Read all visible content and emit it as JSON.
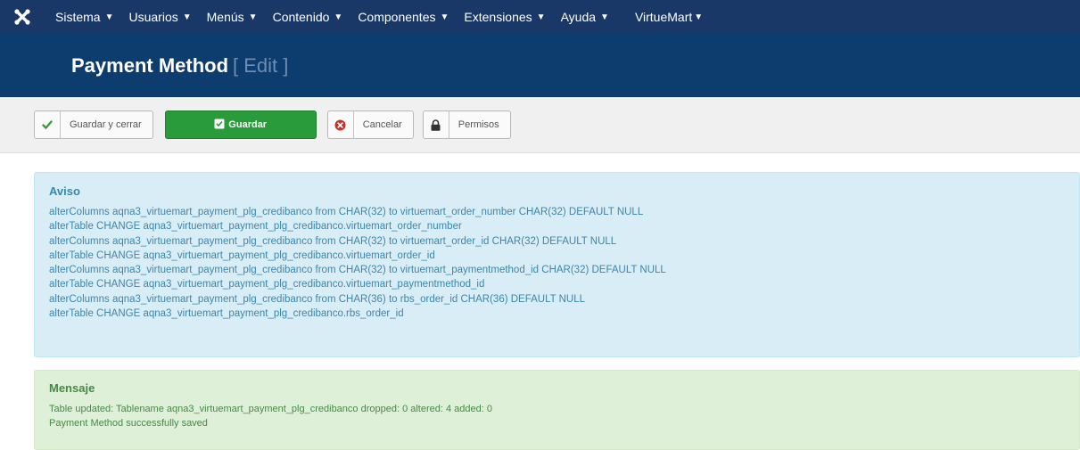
{
  "nav": {
    "logo_icon": "joomla-logo-icon",
    "items": [
      {
        "label": "Sistema"
      },
      {
        "label": "Usuarios"
      },
      {
        "label": "Menús"
      },
      {
        "label": "Contenido"
      },
      {
        "label": "Componentes"
      },
      {
        "label": "Extensiones"
      },
      {
        "label": "Ayuda"
      },
      {
        "label": "VirtueMart"
      }
    ]
  },
  "header": {
    "title": "Payment Method",
    "subtitle": "[ Edit ]"
  },
  "toolbar": {
    "save_close_label": "Guardar y cerrar",
    "save_label": "Guardar",
    "cancel_label": "Cancelar",
    "permissions_label": "Permisos"
  },
  "notice": {
    "title": "Aviso",
    "lines": [
      "alterColumns aqna3_virtuemart_payment_plg_credibanco from CHAR(32) to virtuemart_order_number CHAR(32) DEFAULT NULL",
      "alterTable CHANGE aqna3_virtuemart_payment_plg_credibanco.virtuemart_order_number",
      "alterColumns aqna3_virtuemart_payment_plg_credibanco from CHAR(32) to virtuemart_order_id CHAR(32) DEFAULT NULL",
      "alterTable CHANGE aqna3_virtuemart_payment_plg_credibanco.virtuemart_order_id",
      "alterColumns aqna3_virtuemart_payment_plg_credibanco from CHAR(32) to virtuemart_paymentmethod_id CHAR(32) DEFAULT NULL",
      "alterTable CHANGE aqna3_virtuemart_payment_plg_credibanco.virtuemart_paymentmethod_id",
      "alterColumns aqna3_virtuemart_payment_plg_credibanco from CHAR(36) to rbs_order_id CHAR(36) DEFAULT NULL",
      "alterTable CHANGE aqna3_virtuemart_payment_plg_credibanco.rbs_order_id"
    ]
  },
  "message": {
    "title": "Mensaje",
    "lines": [
      "Table updated: Tablename aqna3_virtuemart_payment_plg_credibanco dropped: 0 altered: 4 added: 0",
      "Payment Method successfully saved"
    ]
  },
  "colors": {
    "nav_bg": "#1a3867",
    "header_bg": "#0d3c6e",
    "save_green": "#2a9b3b",
    "info_bg": "#d9edf7",
    "success_bg": "#dff0d8"
  }
}
